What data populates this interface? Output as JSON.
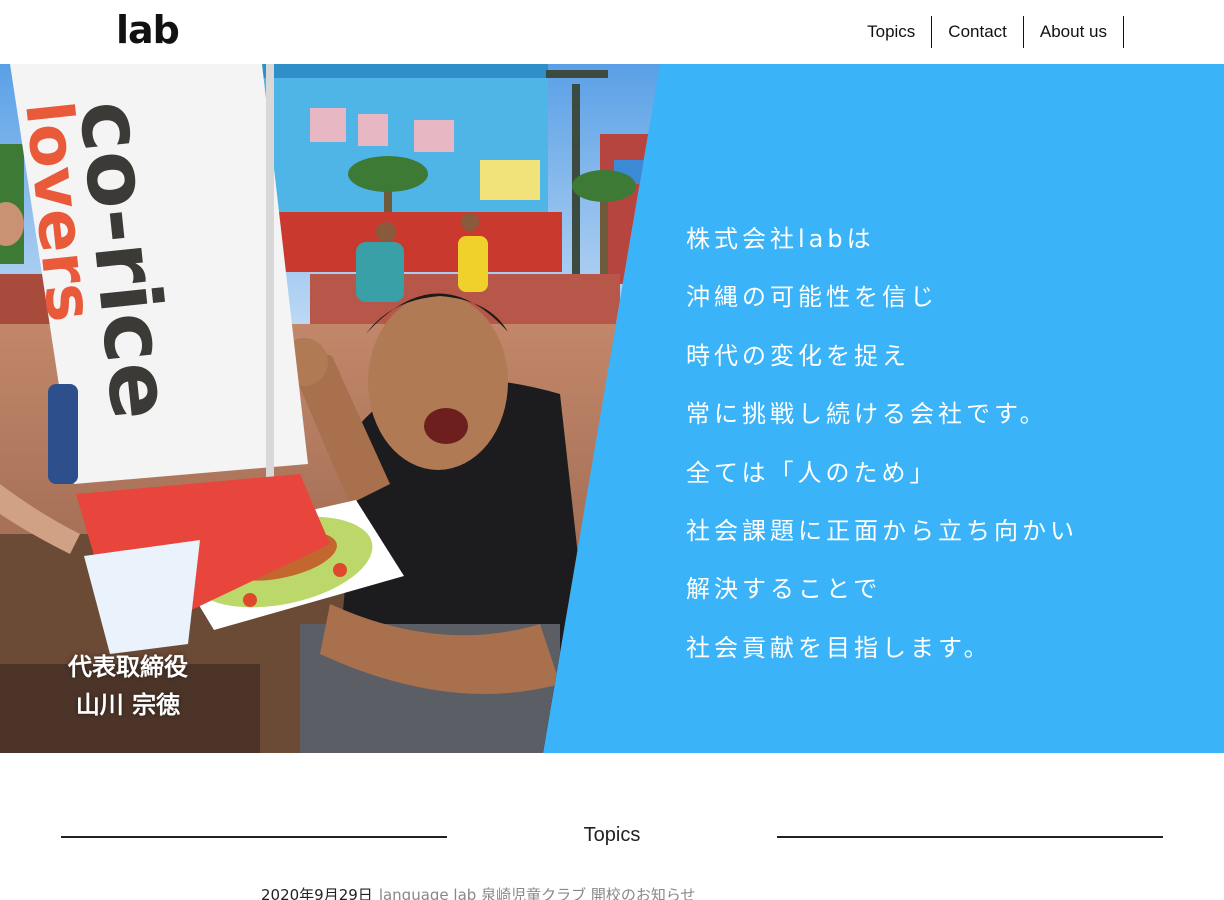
{
  "header": {
    "logo": "lab",
    "nav": [
      "Topics",
      "Contact",
      "About us"
    ]
  },
  "hero": {
    "message_lines": [
      "株式会社labは",
      "沖縄の可能性を信じ",
      "時代の変化を捉え",
      "常に挑戦し続ける会社です。",
      "全ては「人のため」",
      "社会課題に正面から立ち向かい",
      "解決することで",
      "社会貢献を目指します。"
    ],
    "caption_title": "代表取締役",
    "caption_name": "山川 宗徳",
    "banner_text": "co-rice",
    "banner_text_red": "lovers",
    "accent_color": "#3ab3f8"
  },
  "topics": {
    "heading": "Topics",
    "items": [
      {
        "date": "2020年9月29日",
        "title": "language lab 泉崎児童クラブ 開校のお知らせ"
      }
    ]
  }
}
